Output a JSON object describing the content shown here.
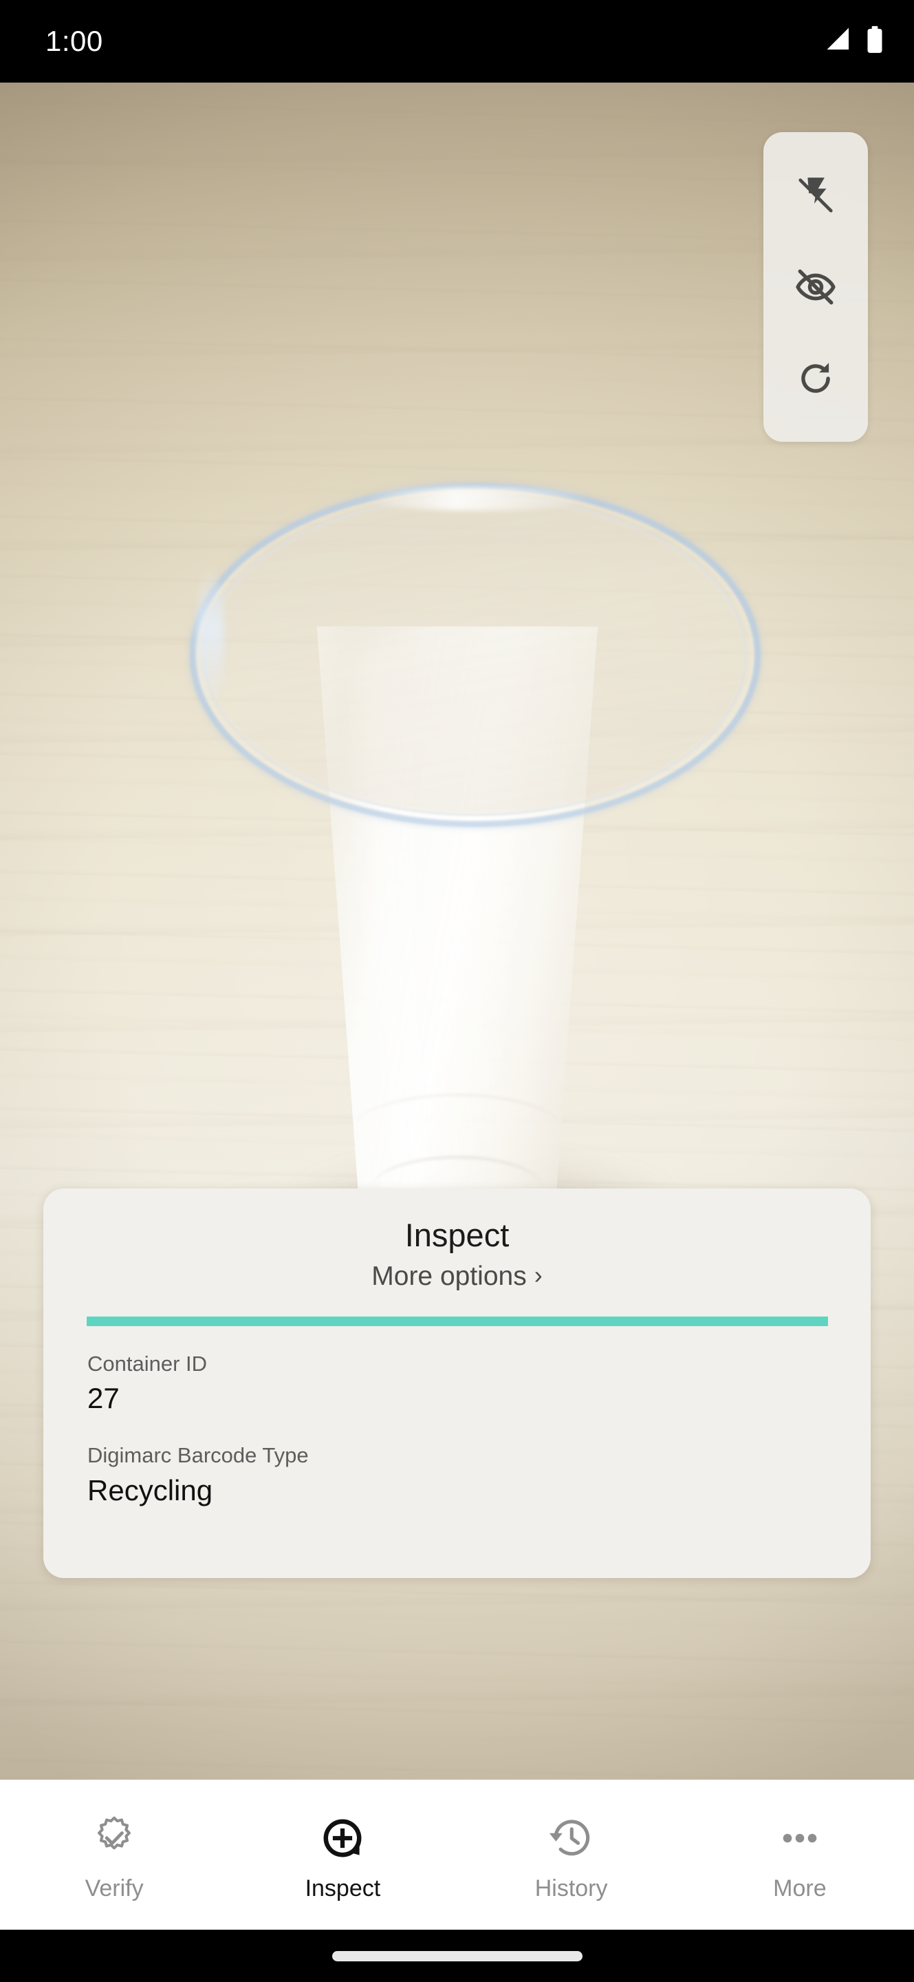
{
  "status_bar": {
    "time": "1:00",
    "icons": [
      {
        "name": "cellular-signal-icon",
        "glyph": "signal"
      },
      {
        "name": "battery-icon",
        "glyph": "battery"
      }
    ]
  },
  "camera": {
    "scene_description": "Translucent plastic cup on a light wooden table",
    "controls": [
      {
        "name": "flash-off-icon",
        "label": "Flash off"
      },
      {
        "name": "visibility-off-icon",
        "label": "Overlay hidden"
      },
      {
        "name": "refresh-icon",
        "label": "Reset"
      }
    ]
  },
  "card": {
    "title": "Inspect",
    "more_options_label": "More options",
    "more_options_chevron": "›",
    "accent_color": "#5fd5c1",
    "fields": [
      {
        "label": "Container ID",
        "value": "27"
      },
      {
        "label": "Digimarc Barcode Type",
        "value": "Recycling"
      }
    ]
  },
  "bottom_nav": {
    "items": [
      {
        "label": "Verify",
        "icon": "verified-badge-icon",
        "active": false
      },
      {
        "label": "Inspect",
        "icon": "inspect-plus-pin-icon",
        "active": true
      },
      {
        "label": "History",
        "icon": "history-clock-icon",
        "active": false
      },
      {
        "label": "More",
        "icon": "more-dots-icon",
        "active": false
      }
    ]
  },
  "gesture_bar": {
    "home_indicator": "home-indicator"
  }
}
